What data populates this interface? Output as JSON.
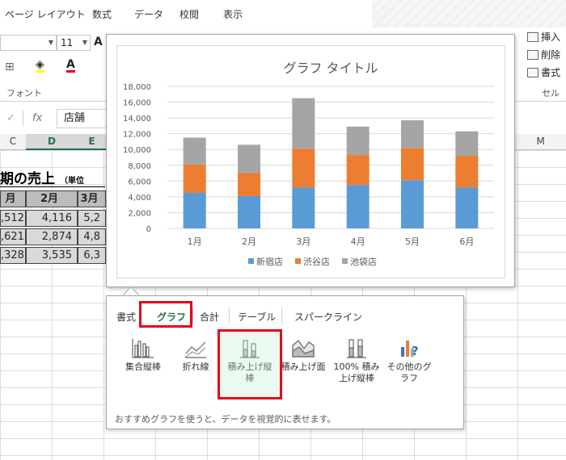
{
  "ribbon": {
    "tabs": [
      "ページ レイアウト",
      "数式",
      "データ",
      "校閲",
      "表示"
    ],
    "font_size": "11",
    "font_group_label": "フォント",
    "cells_group_label": "セル",
    "cells_commands": [
      "挿入",
      "削除",
      "書式"
    ]
  },
  "formula_bar": {
    "value": "店舗"
  },
  "sheet": {
    "columns": [
      "C",
      "D",
      "E",
      "M"
    ],
    "title": "期の売上",
    "title_note": "（単位",
    "months": [
      "月",
      "2月",
      "3月"
    ],
    "rows": [
      [
        ",512",
        "4,116",
        "5,2"
      ],
      [
        ",621",
        "2,874",
        "4,8"
      ],
      [
        ",328",
        "3,535",
        "6,3"
      ]
    ]
  },
  "chart": {
    "colors": {
      "shinjuku": "#5b9bd5",
      "shibuya": "#ed7d31",
      "ikebukuro": "#a5a5a5"
    }
  },
  "chart_data": {
    "type": "bar",
    "stacked": true,
    "title": "グラフ タイトル",
    "categories": [
      "1月",
      "2月",
      "3月",
      "4月",
      "5月",
      "6月"
    ],
    "series": [
      {
        "name": "新宿店",
        "values": [
          4500,
          4100,
          5200,
          5500,
          6100,
          5200
        ]
      },
      {
        "name": "渋谷店",
        "values": [
          3600,
          2900,
          4900,
          3800,
          4100,
          4000
        ]
      },
      {
        "name": "池袋店",
        "values": [
          3400,
          3600,
          6400,
          3600,
          3500,
          3100
        ]
      }
    ],
    "ylim": [
      0,
      18000
    ],
    "yticks": [
      "0",
      "2,000",
      "4,000",
      "6,000",
      "8,000",
      "10,000",
      "12,000",
      "14,000",
      "16,000",
      "18,000"
    ],
    "grid": true,
    "legend": "bottom"
  },
  "quick_analysis": {
    "tabs": [
      "書式",
      "グラフ",
      "合計",
      "テーブル",
      "スパークライン"
    ],
    "items": [
      {
        "label": "集合縦棒",
        "icon": "clustered-column-icon"
      },
      {
        "label": "折れ線",
        "icon": "line-chart-icon"
      },
      {
        "label": "積み上げ縦棒",
        "icon": "stacked-column-icon"
      },
      {
        "label": "積み上げ面",
        "icon": "stacked-area-icon"
      },
      {
        "label": "100% 積み上げ縦棒",
        "icon": "percent-stacked-column-icon"
      },
      {
        "label": "その他のグラフ",
        "icon": "more-charts-icon"
      }
    ],
    "hint": "おすすめグラフを使うと、データを視覚的に表せます。"
  }
}
